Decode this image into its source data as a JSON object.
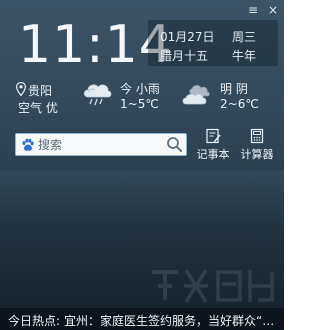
{
  "window": {
    "menu_icon": "≡",
    "close_icon": "×"
  },
  "clock": {
    "time": "11:14"
  },
  "calendar": {
    "date": "01月27日",
    "weekday": "周三",
    "lunar_date": "腊月十五",
    "lunar_year": "牛年"
  },
  "location": {
    "city": "贵阳",
    "air_quality": "空气 优"
  },
  "forecast": [
    {
      "icon": "rain-cloud-icon",
      "condition": "今 小雨",
      "temperature": "1~5℃"
    },
    {
      "icon": "overcast-cloud-icon",
      "condition": "明 阴",
      "temperature": "2~6℃"
    }
  ],
  "search": {
    "placeholder": "搜索"
  },
  "tools": {
    "notepad_label": "记事本",
    "calculator_label": "计算器"
  },
  "hot_news": {
    "label": "今日热点:",
    "text": "宜州：家庭医生签约服务，当好群众“…"
  },
  "colors": {
    "background_top": "#3d5466",
    "background_bottom": "#14202a",
    "search_border": "#8fb4d6",
    "baidu_blue": "#2f6fd8"
  }
}
